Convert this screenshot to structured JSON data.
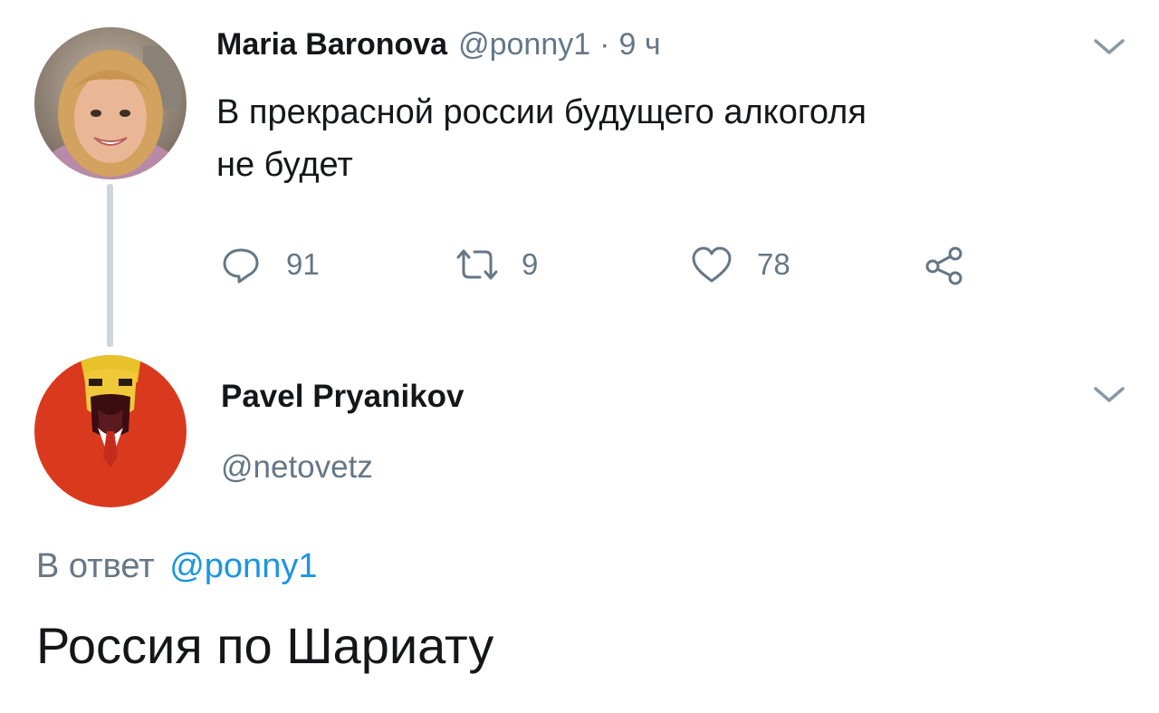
{
  "original_tweet": {
    "display_name": "Maria Baronova",
    "handle": "@ponny1",
    "separator": "·",
    "time": "9 ч",
    "text_line1": "В прекрасной россии будущего алкоголя",
    "text_line2": "не будет",
    "actions": {
      "reply_count": "91",
      "retweet_count": "9",
      "like_count": "78"
    }
  },
  "reply_tweet": {
    "display_name": "Pavel Pryanikov",
    "handle": "@netovetz",
    "in_reply_prefix": "В ответ",
    "in_reply_handle": "@ponny1",
    "text": "Россия по Шариату"
  },
  "colors": {
    "text": "#14171a",
    "muted": "#657786",
    "link": "#1b95e0",
    "thread_line": "#ccd6dd"
  },
  "icons": [
    "reply-icon",
    "retweet-icon",
    "like-icon",
    "share-icon",
    "chevron-down-icon"
  ]
}
